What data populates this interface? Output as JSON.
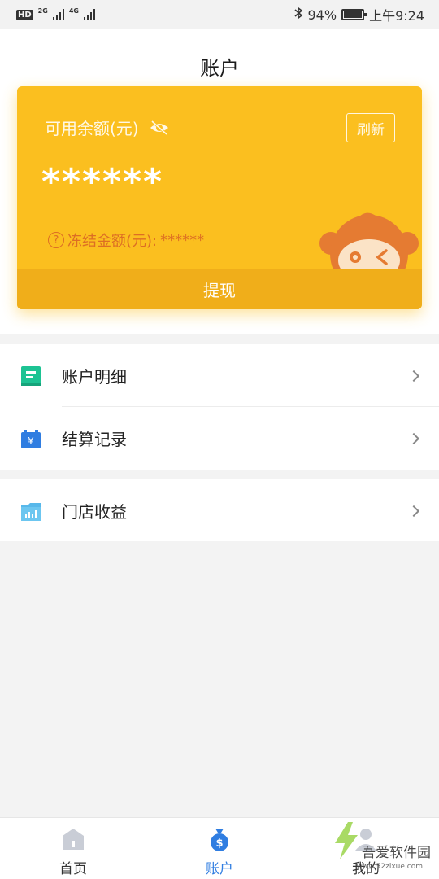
{
  "status_bar": {
    "left_badge": "HD",
    "net1": "2G",
    "net2": "4G",
    "battery": "94%",
    "time": "上午9:24"
  },
  "header": {
    "title": "账户"
  },
  "card": {
    "balance_label": "可用余额(元)",
    "refresh_label": "刷新",
    "balance_value": "******",
    "frozen_label": "冻结金额(元):",
    "frozen_value": "******",
    "withdraw_label": "提现",
    "colors": {
      "card": "#fbbf1f",
      "button": "#f0ae1a",
      "frozen_text": "#dd6e24"
    }
  },
  "menu": {
    "group1": [
      {
        "label": "账户明细",
        "icon": "document-green-icon"
      },
      {
        "label": "结算记录",
        "icon": "yuan-blue-icon"
      }
    ],
    "group2": [
      {
        "label": "门店收益",
        "icon": "chart-blue-icon"
      }
    ]
  },
  "bottom_nav": [
    {
      "label": "首页",
      "icon": "home-icon"
    },
    {
      "label": "账户",
      "icon": "money-bag-icon",
      "active": true
    },
    {
      "label": "我的",
      "icon": "person-icon"
    }
  ],
  "watermark": {
    "text": "吾爱软件园",
    "url": "www.52zixue.com"
  },
  "accent_color": "#2f7de1"
}
